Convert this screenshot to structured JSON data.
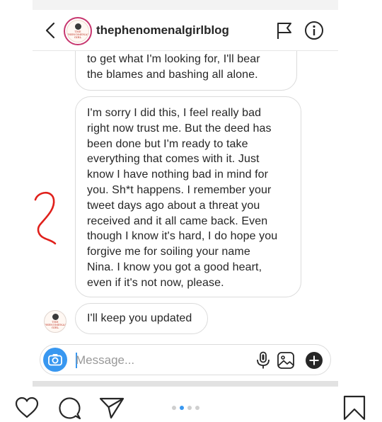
{
  "header": {
    "username": "thephenomenalgirlblog",
    "avatar_logo_text": "THE PHENOMENAL GIRL"
  },
  "messages": [
    {
      "text": "to get what I'm looking for, I'll bear\nthe blames and bashing all alone."
    },
    {
      "text": "I'm sorry I did this, I feel really bad\nright now trust me. But the deed has\nbeen done but I'm ready to take\neverything that comes with it. Just\nknow I have nothing bad in mind for\nyou. Sh*t happens. I remember your\ntweet days ago about a threat you\nreceived and it all came back. Even\nthough I know it's hard, I do hope you\nforgive me for soiling your name\nNina. I know you got a good heart,\neven if it's not now, please."
    },
    {
      "text": "I'll keep you updated"
    }
  ],
  "composer": {
    "placeholder": "Message..."
  },
  "icons": {
    "back": "chevron-left-icon",
    "flag": "flag-icon",
    "info": "info-icon",
    "camera": "camera-icon",
    "mic": "microphone-icon",
    "gallery": "image-icon",
    "plus": "plus-icon",
    "like": "heart-icon",
    "comment": "comment-icon",
    "share": "paper-plane-icon",
    "save": "bookmark-icon"
  },
  "carousel": {
    "count": 4,
    "active": 2
  },
  "colors": {
    "accent": "#3897f0",
    "avatar_ring": "#c7376f",
    "scribble": "#e0201b",
    "bubble_border": "#dbdbdb"
  }
}
